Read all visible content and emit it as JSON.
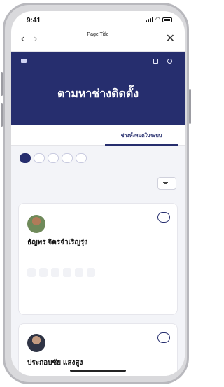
{
  "status": {
    "time": "9:41"
  },
  "nav": {
    "back": "‹",
    "forward": "›",
    "title": "Page Title",
    "subtitle": "",
    "close": "✕"
  },
  "hero": {
    "brand_line1": "",
    "brand_line2": "",
    "link_left": "",
    "link_right": "",
    "title": "ตามหาช่างติดตั้ง",
    "subtitle": ""
  },
  "tabs": [
    {
      "label": "",
      "active": false
    },
    {
      "label": "ช่างทั้งหมดในระบบ",
      "active": true
    }
  ],
  "chips": [
    {
      "label": "",
      "active": true
    },
    {
      "label": "",
      "active": false
    },
    {
      "label": "",
      "active": false
    },
    {
      "label": "",
      "active": false
    },
    {
      "label": "",
      "active": false
    }
  ],
  "list": {
    "count": "",
    "filter_label": ""
  },
  "cards": [
    {
      "detail_label": "",
      "name": "ธัญพร จิตรจำเริญรุ่ง",
      "meta1": "",
      "meta2": "",
      "tags": [
        "",
        "",
        "",
        "",
        "",
        ""
      ]
    },
    {
      "detail_label": "",
      "name": "ประกอบชัย แสงสูง"
    }
  ]
}
